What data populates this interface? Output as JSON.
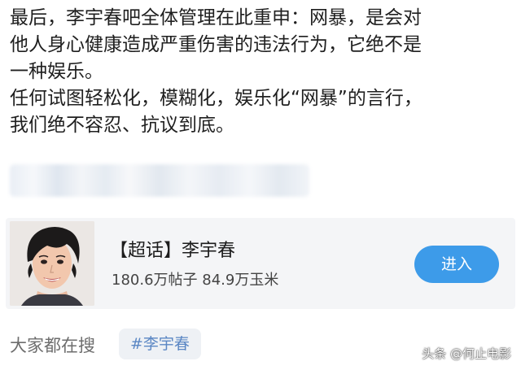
{
  "post": {
    "lines": [
      "最后，李宇春吧全体管理在此重申：网暴，是会对",
      "他人身心健康造成严重伤害的违法行为，它绝不是",
      "一种娱乐。",
      "任何试图轻松化，模糊化，娱乐化“网暴”的言行，",
      "我们绝不容忍、抗议到底。"
    ]
  },
  "topic_card": {
    "title": "【超话】李宇春",
    "stats": "180.6万帖子  84.9万玉米",
    "enter_label": "进入",
    "button_color": "#3d9be9"
  },
  "search": {
    "label": "大家都在搜",
    "tag": "#李宇春"
  },
  "watermark": {
    "text": "头条 @何止电影"
  }
}
